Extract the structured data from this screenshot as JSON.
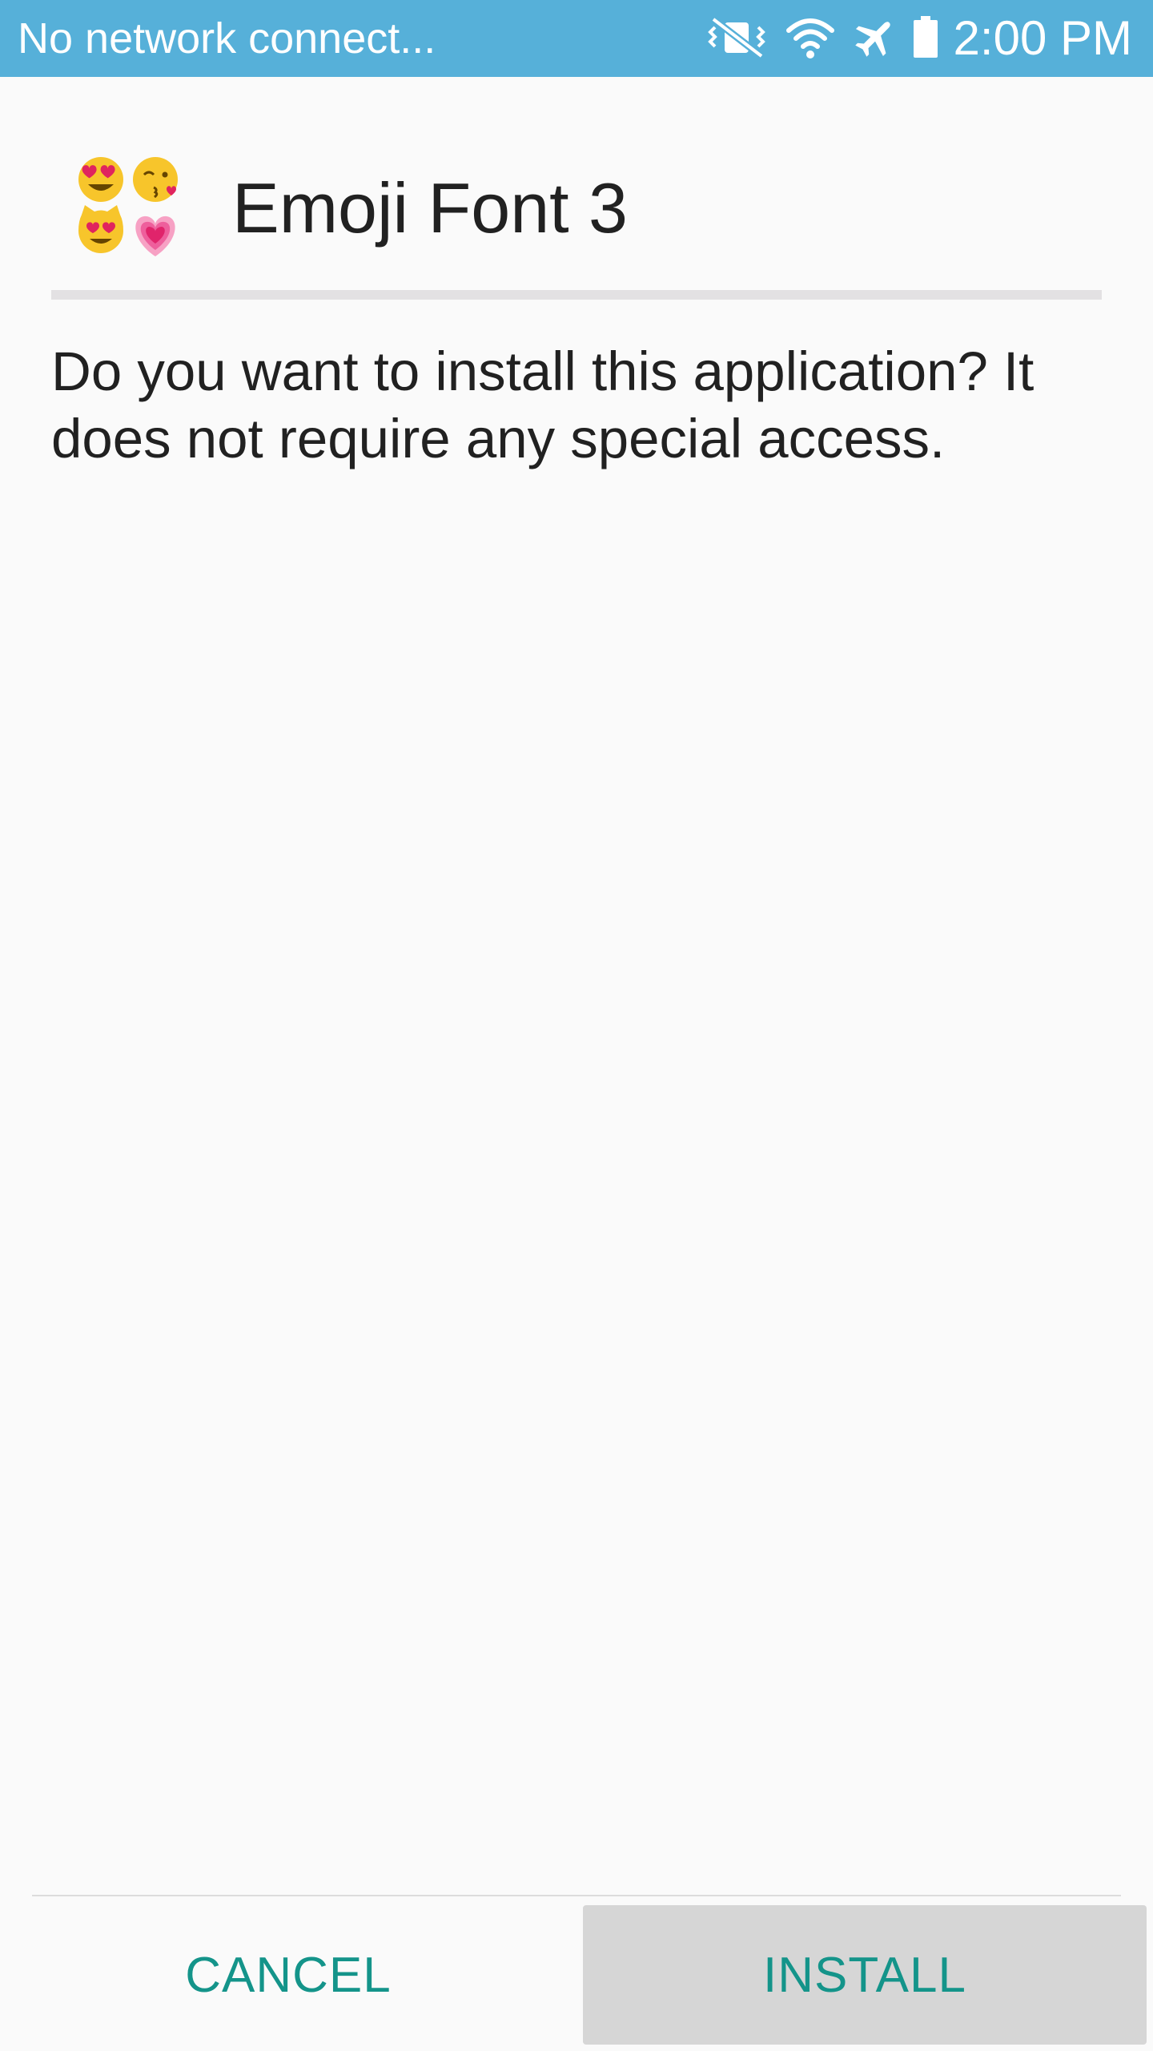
{
  "status_bar": {
    "network_text": "No network connect...",
    "time": "2:00 PM",
    "icons": [
      "vibrate-mute-icon",
      "wifi-icon",
      "airplane-mode-icon",
      "battery-icon"
    ],
    "background_color": "#56b0d9"
  },
  "dialog": {
    "app_name": "Emoji Font 3",
    "app_icon": "emoji-cluster-icon",
    "message": "Do you want to install this application? It does not require any special access.",
    "cancel_label": "CANCEL",
    "install_label": "INSTALL",
    "accent_color": "#14948a"
  }
}
